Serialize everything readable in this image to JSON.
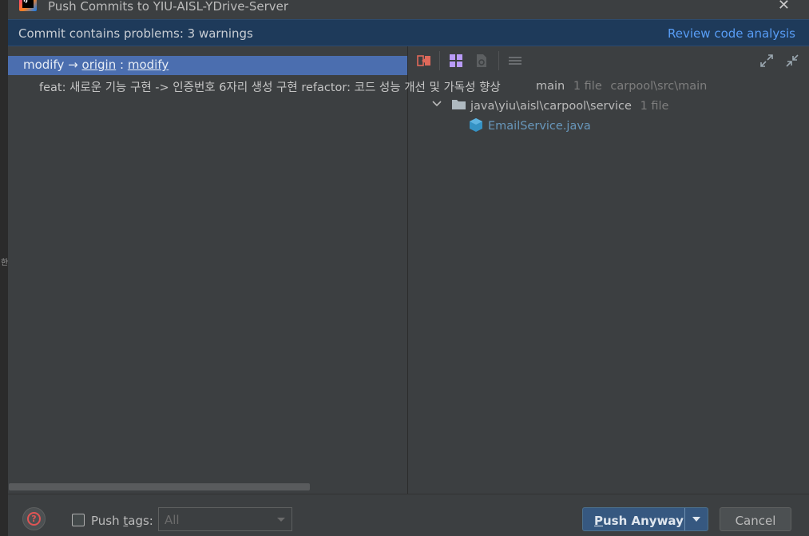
{
  "window": {
    "title": "Push Commits to YIU-AISL-YDrive-Server",
    "app_icon_text": "IJ"
  },
  "left_strip": {
    "ime_indicator": "한"
  },
  "banner": {
    "message": "Commit contains problems: 3 warnings",
    "link": "Review code analysis"
  },
  "commits": {
    "branch": {
      "local": "modify",
      "arrow": "→",
      "remote": "origin",
      "separator": ":",
      "target": "modify"
    },
    "items": [
      {
        "message": "feat: 새로운 기능 구현 -> 인증번호 6자리 생성 구현 refactor: 코드 성능 개선 및 가독성 향상"
      }
    ]
  },
  "changes": {
    "toolbar": [
      "show-diff-icon",
      "group-by-icon",
      "open-source-icon",
      "expand-all-icon",
      "collapse-icon"
    ],
    "tree": [
      {
        "label": "main",
        "count": "1 file",
        "path": "carpool\\src\\main"
      },
      {
        "label": "java\\yiu\\aisl\\carpool\\service",
        "count": "1 file"
      },
      {
        "label": "EmailService.java"
      }
    ]
  },
  "footer": {
    "push_tags_label_pre": "Push ",
    "push_tags_label_u": "t",
    "push_tags_label_post": "ags:",
    "push_tags_checked": false,
    "tags_select_value": "All",
    "push_button_u": "P",
    "push_button_rest": "ush Anyway",
    "cancel_button": "Cancel"
  },
  "colors": {
    "selection": "#4b6eaf",
    "banner": "#1e3a5a",
    "link": "#589df6",
    "primary_button": "#365880"
  }
}
